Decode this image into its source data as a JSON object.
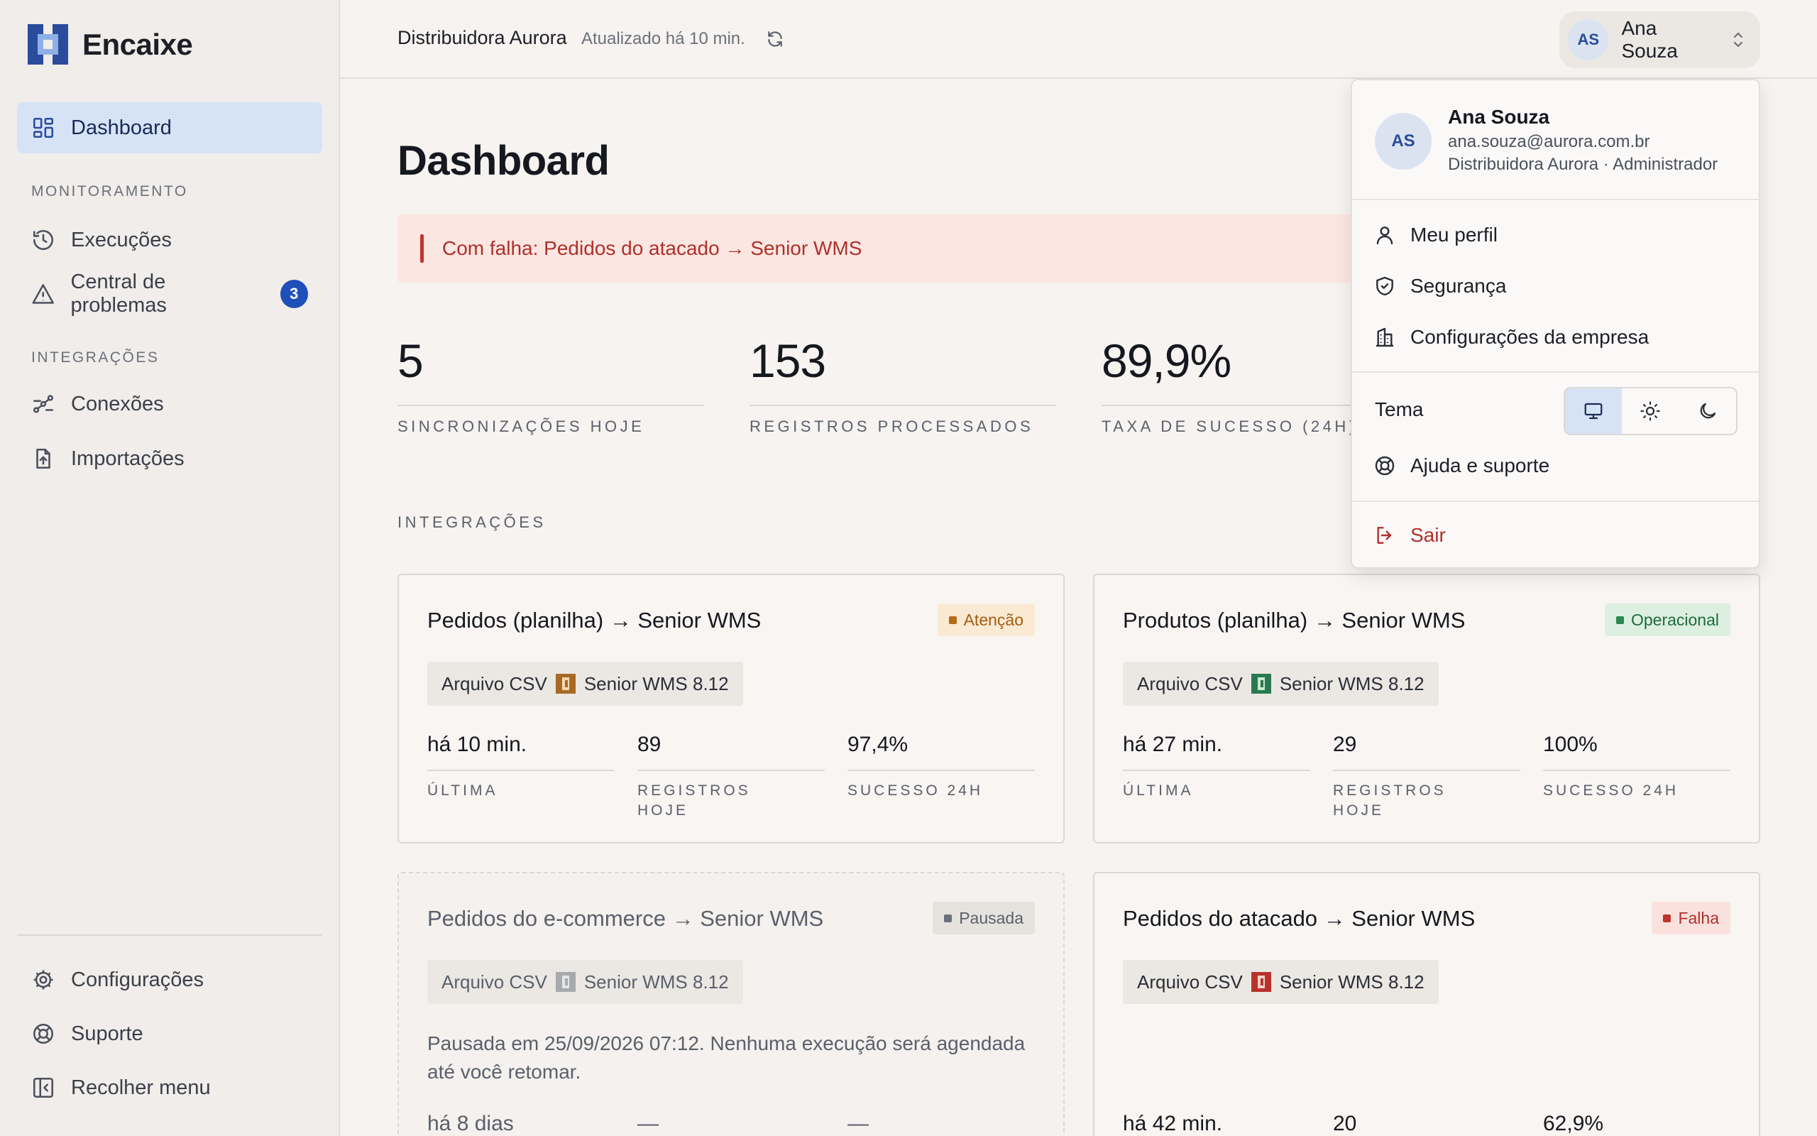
{
  "brand": {
    "name": "Encaixe"
  },
  "sidebar": {
    "items": [
      {
        "label": "Dashboard"
      },
      {
        "label": "Execuções"
      },
      {
        "label": "Central de problemas",
        "badge": "3"
      },
      {
        "label": "Conexões"
      },
      {
        "label": "Importações"
      }
    ],
    "sections": {
      "monitoring": "MONITORAMENTO",
      "integrations": "INTEGRAÇÕES"
    },
    "footer": [
      {
        "label": "Configurações"
      },
      {
        "label": "Suporte"
      },
      {
        "label": "Recolher menu"
      }
    ]
  },
  "topbar": {
    "org": "Distribuidora Aurora",
    "updated": "Atualizado há 10 min.",
    "user": {
      "initials": "AS",
      "name": "Ana Souza"
    }
  },
  "main": {
    "title": "Dashboard",
    "alert": "Com falha: Pedidos do atacado → Senior WMS",
    "stats": [
      {
        "value": "5",
        "label": "SINCRONIZAÇÕES HOJE"
      },
      {
        "value": "153",
        "label": "REGISTROS PROCESSADOS"
      },
      {
        "value": "89,9%",
        "label": "TAXA DE SUCESSO (24H)"
      }
    ],
    "section_title": "INTEGRAÇÕES",
    "cards": [
      {
        "title": "Pedidos (planilha) → Senior WMS",
        "status": "Atenção",
        "source": "Arquivo CSV",
        "target": "Senior WMS 8.12",
        "metrics": [
          {
            "value": "há 10 min.",
            "label": "ÚLTIMA"
          },
          {
            "value": "89",
            "label": "REGISTROS HOJE"
          },
          {
            "value": "97,4%",
            "label": "SUCESSO 24H"
          }
        ]
      },
      {
        "title": "Produtos (planilha) → Senior WMS",
        "status": "Operacional",
        "source": "Arquivo CSV",
        "target": "Senior WMS 8.12",
        "metrics": [
          {
            "value": "há 27 min.",
            "label": "ÚLTIMA"
          },
          {
            "value": "29",
            "label": "REGISTROS HOJE"
          },
          {
            "value": "100%",
            "label": "SUCESSO 24H"
          }
        ]
      },
      {
        "title": "Pedidos do e-commerce → Senior WMS",
        "status": "Pausada",
        "source": "Arquivo CSV",
        "target": "Senior WMS 8.12",
        "note": "Pausada em 25/09/2026 07:12. Nenhuma execução será agendada até você retomar.",
        "metrics": [
          {
            "value": "há 8 dias"
          },
          {
            "value": "—"
          },
          {
            "value": "—"
          }
        ]
      },
      {
        "title": "Pedidos do atacado → Senior WMS",
        "status": "Falha",
        "source": "Arquivo CSV",
        "target": "Senior WMS 8.12",
        "metrics": [
          {
            "value": "há 42 min."
          },
          {
            "value": "20"
          },
          {
            "value": "62,9%"
          }
        ]
      }
    ]
  },
  "dropdown": {
    "initials": "AS",
    "name": "Ana Souza",
    "email": "ana.souza@aurora.com.br",
    "role": "Distribuidora Aurora · Administrador",
    "items": {
      "profile": "Meu perfil",
      "security": "Segurança",
      "company": "Configurações da empresa",
      "theme": "Tema",
      "help": "Ajuda e suporte",
      "logout": "Sair"
    }
  },
  "colors": {
    "accent": "#1f4fb8",
    "active_bg": "#d6e3f7",
    "danger": "#c0342b",
    "success": "#2b8a4f",
    "warning": "#b56a1a"
  }
}
